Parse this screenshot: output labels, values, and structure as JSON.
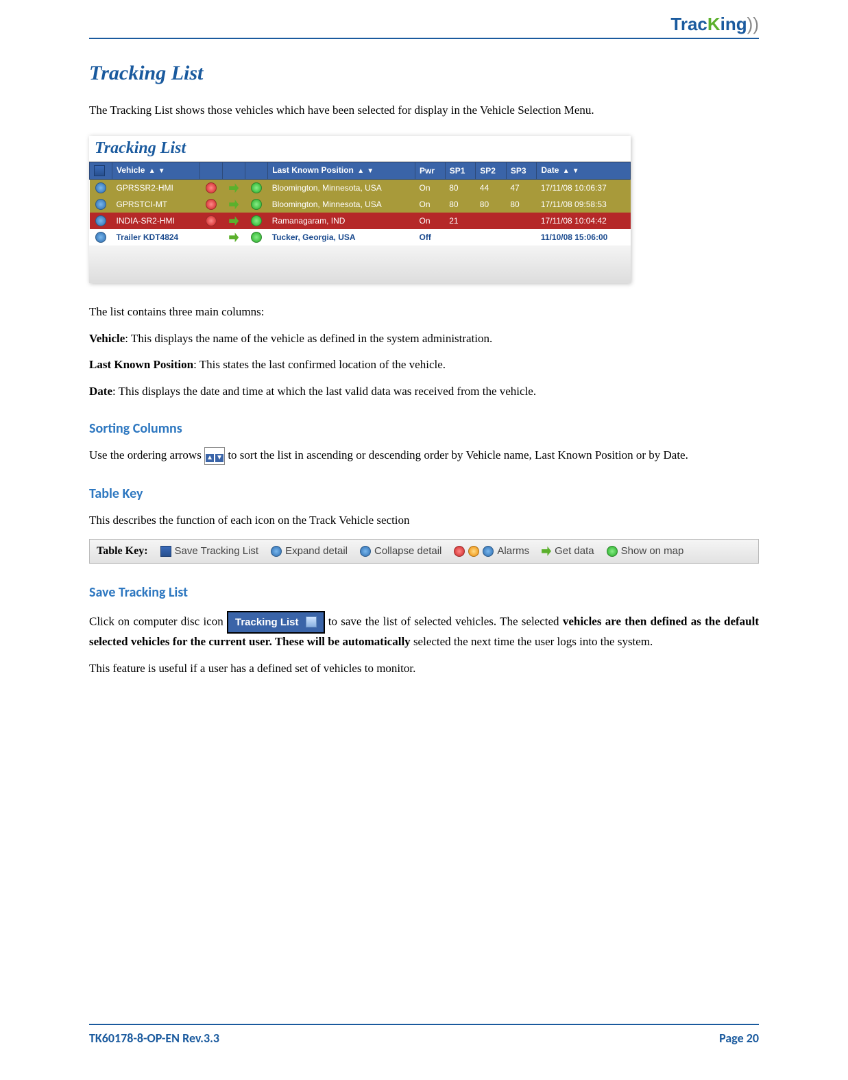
{
  "logo": {
    "trac": "Trac",
    "k": "K",
    "ing": "ing",
    "sym": "))"
  },
  "title": "Tracking List",
  "intro": "The Tracking List shows those vehicles which have been selected for display in the Vehicle Selection Menu.",
  "fig1": {
    "title": "Tracking List",
    "headers": {
      "vehicle": "Vehicle",
      "lkp": "Last Known Position",
      "pwr": "Pwr",
      "sp1": "SP1",
      "sp2": "SP2",
      "sp3": "SP3",
      "date": "Date"
    },
    "rows": [
      {
        "veh": "GPRSSR2-HMI",
        "loc": "Bloomington, Minnesota, USA",
        "pwr": "On",
        "sp1": "80",
        "sp2": "44",
        "sp3": "47",
        "date": "17/11/08 10:06:37",
        "cls": "tl-row-y"
      },
      {
        "veh": "GPRSTCI-MT",
        "loc": "Bloomington, Minnesota, USA",
        "pwr": "On",
        "sp1": "80",
        "sp2": "80",
        "sp3": "80",
        "date": "17/11/08 09:58:53",
        "cls": "tl-row-y"
      },
      {
        "veh": "INDIA-SR2-HMI",
        "loc": "Ramanagaram, IND",
        "pwr": "On",
        "sp1": "21",
        "sp2": "",
        "sp3": "",
        "date": "17/11/08 10:04:42",
        "cls": "tl-row-r"
      },
      {
        "veh": "Trailer KDT4824",
        "loc": "Tucker, Georgia, USA",
        "pwr": "Off",
        "sp1": "",
        "sp2": "",
        "sp3": "",
        "date": "11/10/08 15:06:00",
        "cls": "tl-row-w"
      }
    ]
  },
  "columns": {
    "intro": "The list contains three main columns:",
    "c1": {
      "label": "Vehicle",
      "desc": ": This displays the name of the vehicle as defined in the system administration."
    },
    "c2": {
      "label": "Last Known Position",
      "desc": ": This states the last confirmed location of the vehicle."
    },
    "c3": {
      "label": "Date",
      "desc": ": This displays the date and time at which the last valid data was received from the vehicle."
    }
  },
  "sorting": {
    "heading": "Sorting Columns",
    "p1a": "Use the ordering arrows ",
    "p1b": " to sort the list in ascending or descending order by Vehicle name, Last Known Position or by Date."
  },
  "tablekey": {
    "heading": "Table Key",
    "intro": "This describes the function of each icon on the Track Vehicle section",
    "label": "Table Key:",
    "items": {
      "save": "Save Tracking List",
      "expand": "Expand detail",
      "collapse": "Collapse detail",
      "alarms": "Alarms",
      "getdata": "Get data",
      "showmap": "Show on map"
    }
  },
  "savelist": {
    "heading": "Save Tracking List",
    "p1a": "Click  on  computer  disc  icon  ",
    "btn": "Tracking List",
    "p1b": "  to  save  the  list  of  selected  vehicles.  The selected ",
    "p1c": "vehicles are then defined as the default selected vehicles for the current user. These will be automatically ",
    "p1d": "selected the next time the user logs into the system.",
    "p2": "This feature is useful if a user has a defined set of vehicles to monitor."
  },
  "footer": {
    "left": "TK60178-8-OP-EN Rev.3.3",
    "right_l": "Page  ",
    "right_n": "20"
  }
}
